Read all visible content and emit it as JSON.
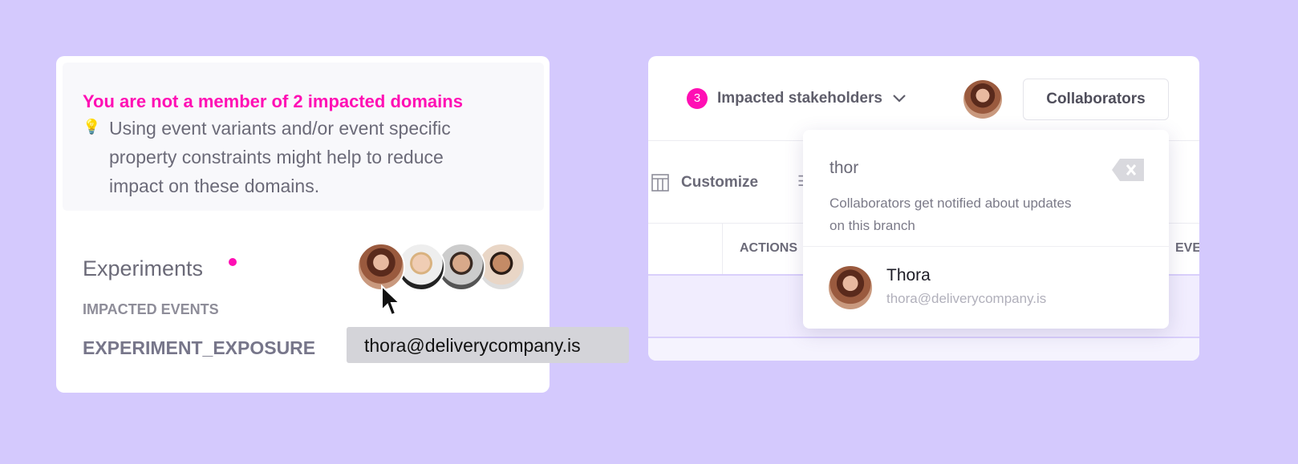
{
  "left_card": {
    "alert": {
      "title": "You are not a member of 2 impacted domains",
      "icon": "lightbulb-icon",
      "lines": [
        "Using event variants and/or event specific",
        "property constraints might help to reduce",
        "impact on these domains."
      ]
    },
    "domain": {
      "name": "Experiments",
      "events_label": "IMPACTED EVENTS",
      "event": "EXPERIMENT_EXPOSURE"
    },
    "tooltip": "thora@deliverycompany.is"
  },
  "right_card": {
    "stakeholders": {
      "count": "3",
      "label": "Impacted stakeholders"
    },
    "collaborators_button": "Collaborators",
    "toolbar": {
      "customize": "Customize"
    },
    "table": {
      "headers": [
        "ACTIONS",
        "EVE"
      ]
    },
    "dropdown": {
      "search_value": "thor",
      "hint_lines": [
        "Collaborators get notified about updates",
        "on this branch"
      ],
      "result": {
        "name": "Thora",
        "email": "thora@deliverycompany.is"
      }
    }
  },
  "colors": {
    "accent": "#ff0fb4",
    "background": "#d4c9fd",
    "row": "#f1edfe"
  }
}
